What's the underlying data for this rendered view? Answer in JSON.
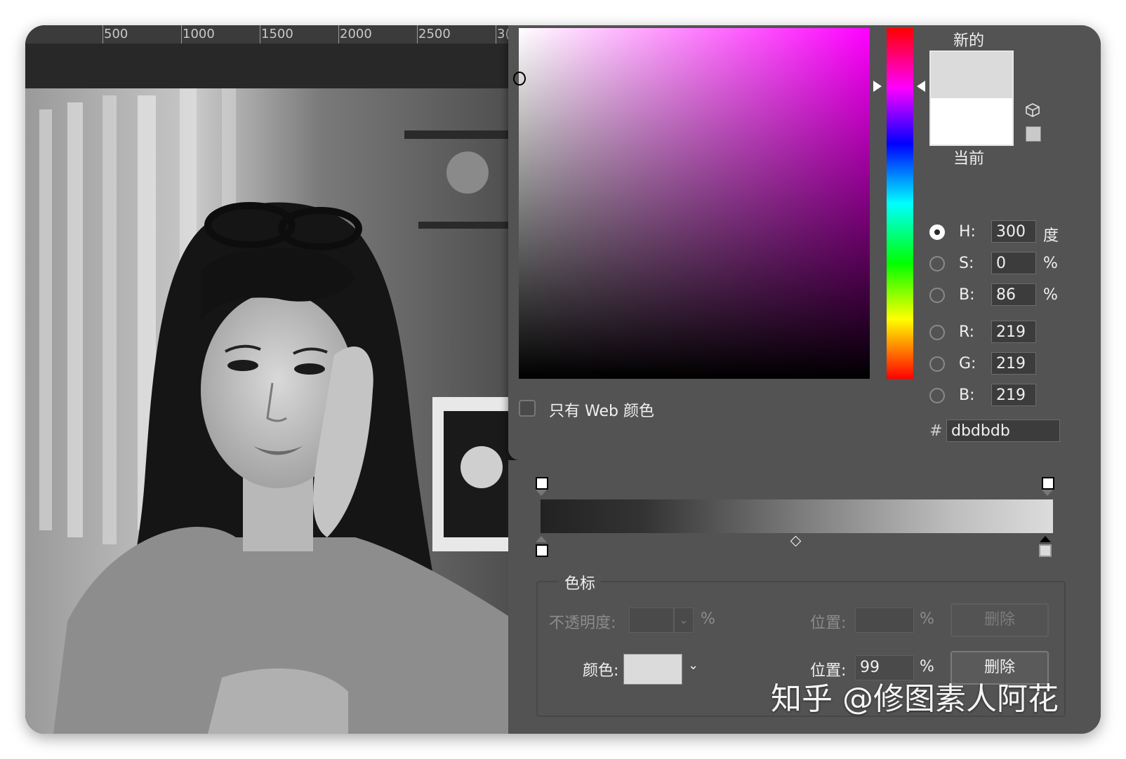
{
  "ruler": {
    "labels": [
      "500",
      "1000",
      "1500",
      "2000",
      "2500",
      "3("
    ]
  },
  "picker": {
    "new_label": "新的",
    "current_label": "当前",
    "new_color": "#dbdbdb",
    "current_color": "#ffffff",
    "hue_color": "#ff00ff",
    "web_only_label": "只有 Web 颜色",
    "fields": [
      {
        "key": "H:",
        "value": "300",
        "unit": "度",
        "selected": true
      },
      {
        "key": "S:",
        "value": "0",
        "unit": "%",
        "selected": false
      },
      {
        "key": "B:",
        "value": "86",
        "unit": "%",
        "selected": false
      },
      {
        "key": "R:",
        "value": "219",
        "unit": "",
        "selected": false
      },
      {
        "key": "G:",
        "value": "219",
        "unit": "",
        "selected": false
      },
      {
        "key": "B:",
        "value": "219",
        "unit": "",
        "selected": false
      }
    ],
    "hex_symbol": "#",
    "hex_value": "dbdbdb",
    "icons": [
      "cube-icon",
      "websafe-swatch"
    ]
  },
  "gradient": {
    "stops_group_label": "色标",
    "opacity_label": "不透明度:",
    "opacity_value": "",
    "opacity_unit": "%",
    "opacity_position_label": "位置:",
    "opacity_position_value": "",
    "opacity_position_unit": "%",
    "opacity_delete_label": "删除",
    "color_label": "颜色:",
    "color_value": "#dbdbdb",
    "color_position_label": "位置:",
    "color_position_value": "99",
    "color_position_unit": "%",
    "color_delete_label": "删除"
  },
  "watermark": "知乎 @修图素人阿花"
}
